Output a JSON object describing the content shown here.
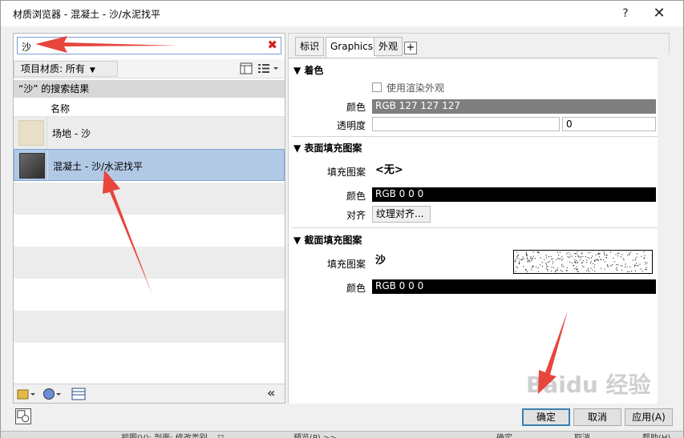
{
  "window": {
    "title": "材质浏览器 - 混凝土 - 沙/水泥找平",
    "help": "?",
    "close": "✕"
  },
  "search": {
    "value": "沙",
    "clear": "✖"
  },
  "library": {
    "crumb": "项目材质: 所有",
    "crumb_arrow": "▼"
  },
  "results": {
    "header": "“沙” 的搜索结果",
    "col_name": "名称",
    "items": [
      {
        "label": "场地 - 沙",
        "swatch": "#e7e0c6"
      },
      {
        "label": "混凝土 - 沙/水泥找平",
        "swatch": "#4c4c4c"
      }
    ]
  },
  "left_footer": {
    "collapse": "«"
  },
  "tabs": [
    {
      "label": "标识"
    },
    {
      "label": "Graphics"
    },
    {
      "label": "外观"
    }
  ],
  "tab_add": "+",
  "shading": {
    "title": "着色",
    "use_render": "使用渲染外观",
    "color_label": "颜色",
    "color_value": "RGB 127 127 127",
    "color_hex": "#7f7f7f",
    "transparency_label": "透明度",
    "transparency_value": "0"
  },
  "surface": {
    "title": "表面填充图案",
    "pattern_label": "填充图案",
    "pattern_value": "<无>",
    "color_label": "颜色",
    "color_value": "RGB 0 0 0",
    "align_label": "对齐",
    "align_button": "纹理对齐..."
  },
  "cut": {
    "title": "截面填充图案",
    "pattern_label": "填充图案",
    "pattern_value": "沙",
    "color_label": "颜色",
    "color_value": "RGB 0 0 0"
  },
  "buttons": {
    "ok": "确定",
    "cancel": "取消",
    "apply": "应用(A)"
  },
  "status": {
    "s1": "视图(V): 剖面: 修改类别... ▽",
    "s2": "预览(P) >>",
    "s3": "确定",
    "s4": "取消",
    "s5": "帮助(H)"
  },
  "watermark": "Baidu 经验"
}
